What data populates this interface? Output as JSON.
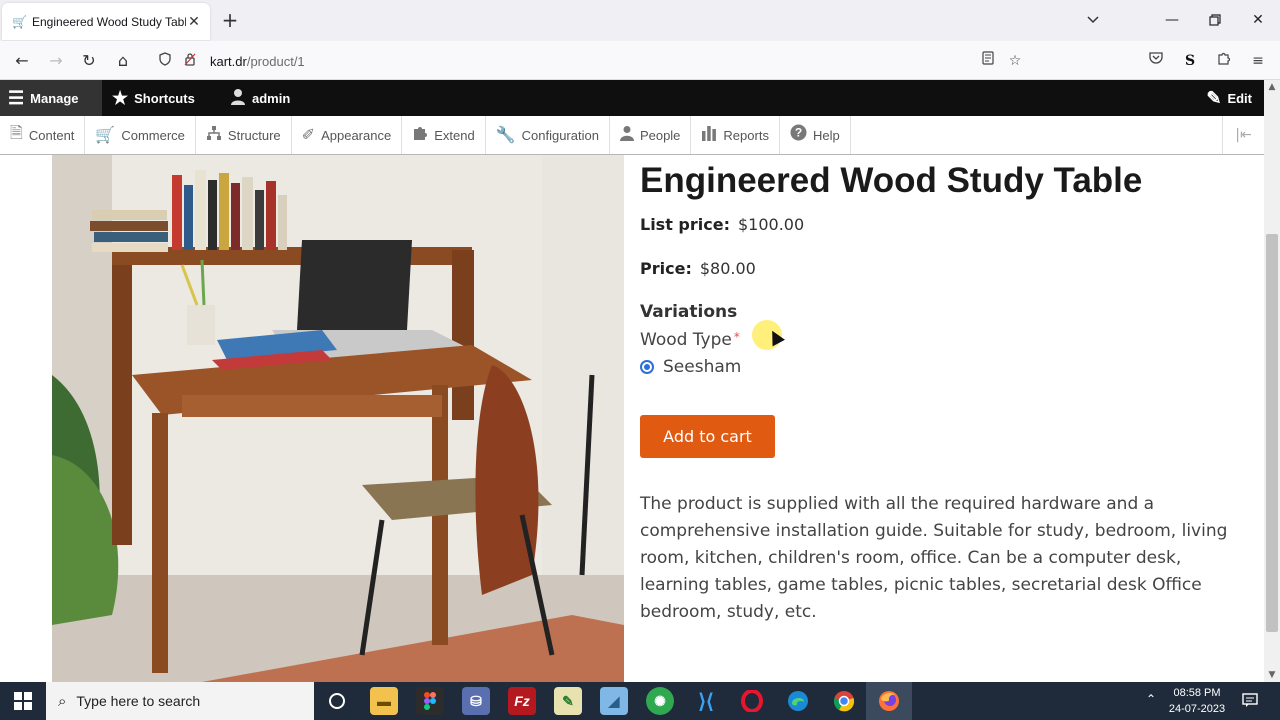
{
  "browser": {
    "tab_title": "Engineered Wood Study Table |",
    "url_host": "kart.dr",
    "url_path": "/product/1"
  },
  "toolbar": {
    "manage": "Manage",
    "shortcuts": "Shortcuts",
    "user": "admin",
    "edit": "Edit"
  },
  "tray": {
    "items": [
      {
        "label": "Content",
        "icon": "document-icon"
      },
      {
        "label": "Commerce",
        "icon": "cart-icon"
      },
      {
        "label": "Structure",
        "icon": "sitemap-icon"
      },
      {
        "label": "Appearance",
        "icon": "brush-icon"
      },
      {
        "label": "Extend",
        "icon": "puzzle-icon"
      },
      {
        "label": "Configuration",
        "icon": "wrench-icon"
      },
      {
        "label": "People",
        "icon": "person-icon"
      },
      {
        "label": "Reports",
        "icon": "bar-chart-icon"
      },
      {
        "label": "Help",
        "icon": "help-icon"
      }
    ]
  },
  "product": {
    "title": "Engineered Wood Study Table",
    "list_price_label": "List price:",
    "list_price": "$100.00",
    "price_label": "Price:",
    "price": "$80.00",
    "variations_heading": "Variations",
    "wood_type_label": "Wood Type",
    "required_mark": "*",
    "wood_option": "Seesham",
    "add_to_cart": "Add to cart",
    "description": "The product is supplied with all the required hardware and a comprehensive installation guide. Suitable for study, bedroom, living room, kitchen, children's room, office. Can be a computer desk, learning tables, game tables, picnic tables, secretarial desk Office bedroom, study, etc."
  },
  "taskbar": {
    "search_placeholder": "Type here to search",
    "time": "08:58 PM",
    "date": "24-07-2023"
  },
  "colors": {
    "cart_button": "#e05a12",
    "toolbar_bg": "#0f0f0f",
    "radio_accent": "#2b6fd8"
  }
}
